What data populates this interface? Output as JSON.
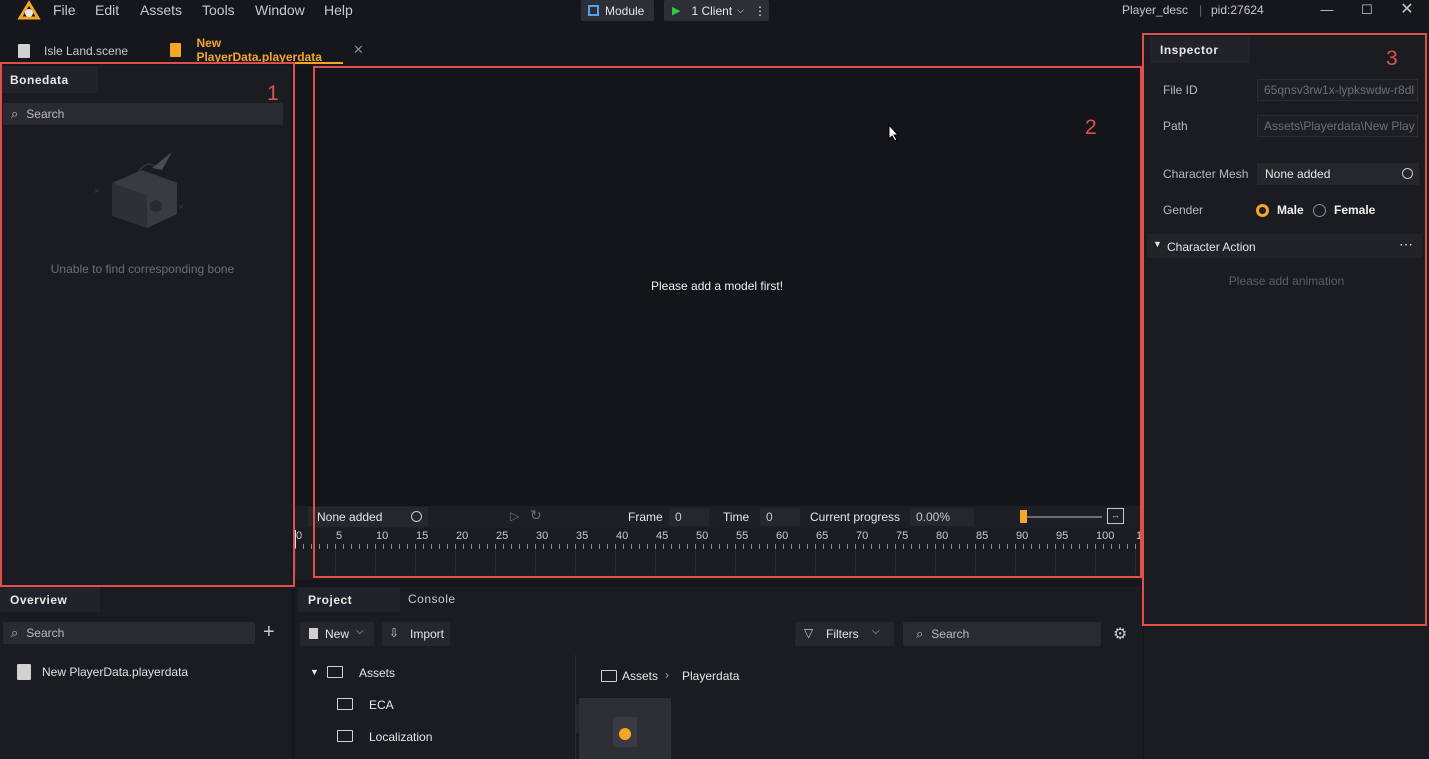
{
  "menu": [
    "File",
    "Edit",
    "Assets",
    "Tools",
    "Window",
    "Help"
  ],
  "toolbar": {
    "module": "Module",
    "client": "1 Client"
  },
  "title": {
    "name": "Player_desc",
    "separator": "|",
    "pid": "pid:27624"
  },
  "tabs": [
    {
      "label": "Isle Land.scene"
    },
    {
      "label": "New PlayerData.playerdata"
    }
  ],
  "bonedata": {
    "title": "Bonedata",
    "search_placeholder": "Search",
    "empty_text": "Unable to find corresponding bone"
  },
  "viewport": {
    "message": "Please add a model first!"
  },
  "timeline": {
    "animation": "None added",
    "frame_label": "Frame",
    "frame_value": "0",
    "time_label": "Time",
    "time_value": "0",
    "progress_label": "Current progress",
    "progress_value": "0.00%",
    "ticks": [
      "0",
      "5",
      "10",
      "15",
      "20",
      "25",
      "30",
      "35",
      "40",
      "45",
      "50",
      "55",
      "60",
      "65",
      "70",
      "75",
      "80",
      "85",
      "90",
      "95",
      "100",
      "1"
    ]
  },
  "inspector": {
    "title": "Inspector",
    "file_id_label": "File ID",
    "file_id_value": "65qnsv3rw1x-lypkswdw-r8dl",
    "path_label": "Path",
    "path_value": "Assets\\Playerdata\\New Play",
    "mesh_label": "Character Mesh",
    "mesh_value": "None added",
    "gender_label": "Gender",
    "gender_male": "Male",
    "gender_female": "Female",
    "action_title": "Character Action",
    "action_empty": "Please add animation"
  },
  "overview": {
    "title": "Overview",
    "search_placeholder": "Search",
    "item": "New PlayerData.playerdata"
  },
  "project": {
    "tab_project": "Project",
    "tab_console": "Console",
    "new_label": "New",
    "import_label": "Import",
    "filters_label": "Filters",
    "search_placeholder": "Search",
    "tree": [
      {
        "label": "Assets"
      },
      {
        "label": "ECA"
      },
      {
        "label": "Localization"
      }
    ],
    "breadcrumb": [
      "Assets",
      "Playerdata"
    ]
  },
  "annotations": [
    "1",
    "2",
    "3"
  ],
  "colors": {
    "accent": "#f5a623",
    "annotation": "#e0504a"
  }
}
